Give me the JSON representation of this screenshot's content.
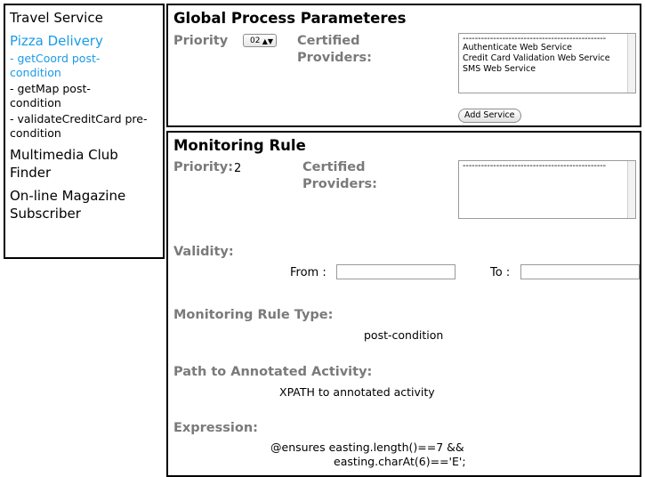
{
  "sidebar": {
    "items": [
      {
        "label": "Travel Service"
      },
      {
        "label": "Pizza Delivery"
      },
      {
        "label": "Multimedia Club Finder"
      },
      {
        "label": "On-line Magazine Subscriber"
      }
    ],
    "subitems": [
      {
        "label": "- getCoord post-condition"
      },
      {
        "label": "- getMap post-condition"
      },
      {
        "label": "- validateCreditCard pre-condition"
      }
    ],
    "selected_color": "#1a9be6"
  },
  "global": {
    "title": "Global Process Parameteres",
    "priority_label": "Priority",
    "priority_value": "02",
    "providers_label": "Certified Providers:",
    "providers_separator": "-----------------------------------------------",
    "providers": [
      "Authenticate Web Service",
      "Credit Card Validation Web Service",
      "SMS Web Service"
    ],
    "add_button": "Add Service"
  },
  "monitor": {
    "title": "Monitoring Rule",
    "priority_label": "Priority:",
    "priority_value": "2",
    "providers_label": "Certified Providers:",
    "providers_separator": "-----------------------------------------------",
    "validity_label": "Validity:",
    "from_label": "From :",
    "to_label": "To :",
    "from_value": "",
    "to_value": "",
    "type_label": "Monitoring Rule Type:",
    "type_value": "post-condition",
    "path_label": "Path to Annotated Activity:",
    "path_value": "XPATH to annotated activity",
    "expr_label": "Expression:",
    "expr_line1": "@ensures easting.length()==7 &&",
    "expr_line2": "easting.charAt(6)=='E';"
  }
}
